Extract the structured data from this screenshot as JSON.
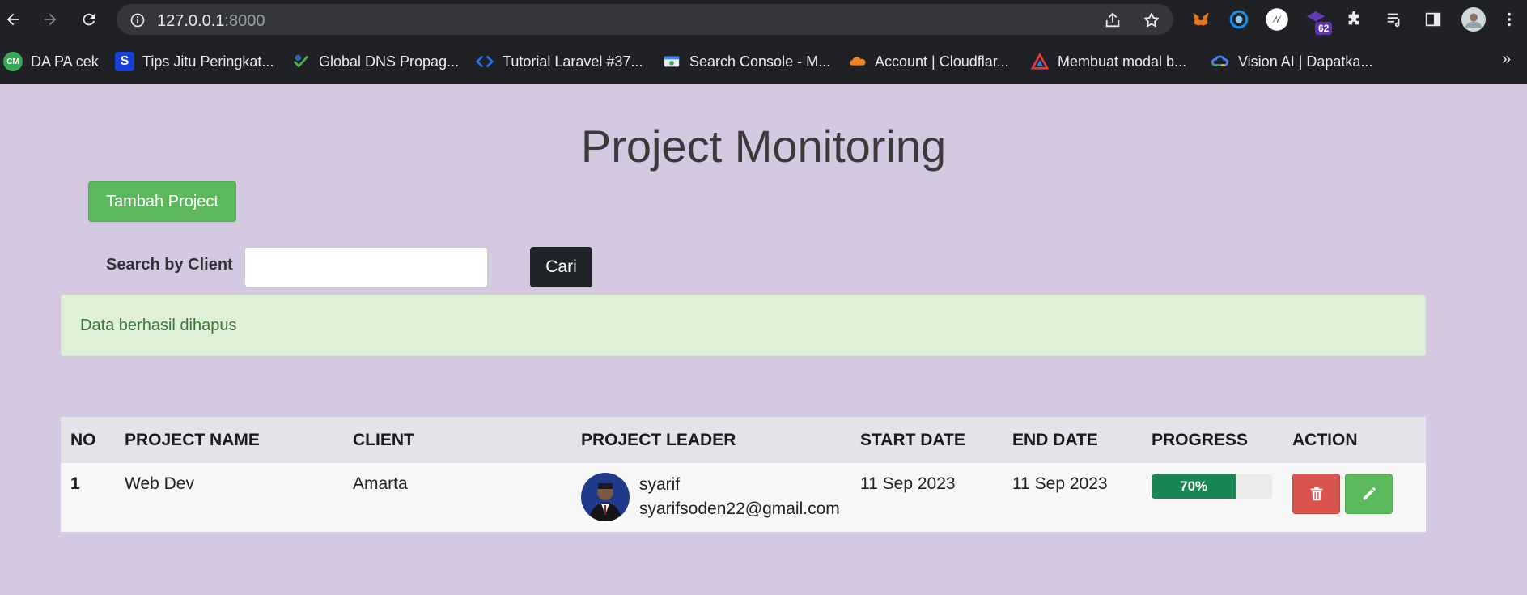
{
  "browser": {
    "url_host": "127.0.0.1",
    "url_port": ":8000",
    "extension_badge": "62",
    "bookmarks": [
      {
        "label": "DA PA cek",
        "icon": "cm-icon",
        "icon_text": "CM",
        "color": "#34a853"
      },
      {
        "label": "Tips Jitu Peringkat...",
        "icon": "s-logo-icon",
        "icon_text": "S",
        "color": "#1a3fd8"
      },
      {
        "label": "Global DNS Propag...",
        "icon": "dns-check-icon",
        "icon_text": "",
        "color": "#2b6cb0"
      },
      {
        "label": "Tutorial Laravel #37...",
        "icon": "code-icon",
        "icon_text": "",
        "color": "#1a73e8"
      },
      {
        "label": "Search Console - M...",
        "icon": "search-console-icon",
        "icon_text": "",
        "color": "#5f6368"
      },
      {
        "label": "Account | Cloudflar...",
        "icon": "cloudflare-icon",
        "icon_text": "",
        "color": "#f48120"
      },
      {
        "label": "Membuat modal b...",
        "icon": "triangle-logo-icon",
        "icon_text": "",
        "color": "#e53935"
      },
      {
        "label": "Vision AI | Dapatka...",
        "icon": "google-cloud-icon",
        "icon_text": "",
        "color": "#4285f4"
      }
    ]
  },
  "page": {
    "title": "Project Monitoring",
    "add_button": "Tambah Project",
    "search_label": "Search by Client",
    "search_value": "",
    "search_button": "Cari",
    "alert": "Data berhasil dihapus"
  },
  "table": {
    "headers": [
      "NO",
      "PROJECT NAME",
      "CLIENT",
      "PROJECT LEADER",
      "START DATE",
      "END DATE",
      "PROGRESS",
      "ACTION"
    ],
    "rows": [
      {
        "no": "1",
        "project_name": "Web Dev",
        "client": "Amarta",
        "leader_name": "syarif",
        "leader_email": "syarifsoden22@gmail.com",
        "start_date": "11 Sep 2023",
        "end_date": "11 Sep 2023",
        "progress_label": "70%",
        "progress_value": 70
      }
    ]
  },
  "colors": {
    "page_bg": "#d4c9e1",
    "success": "#5cb85c",
    "danger": "#d9534f",
    "progress": "#198754"
  }
}
